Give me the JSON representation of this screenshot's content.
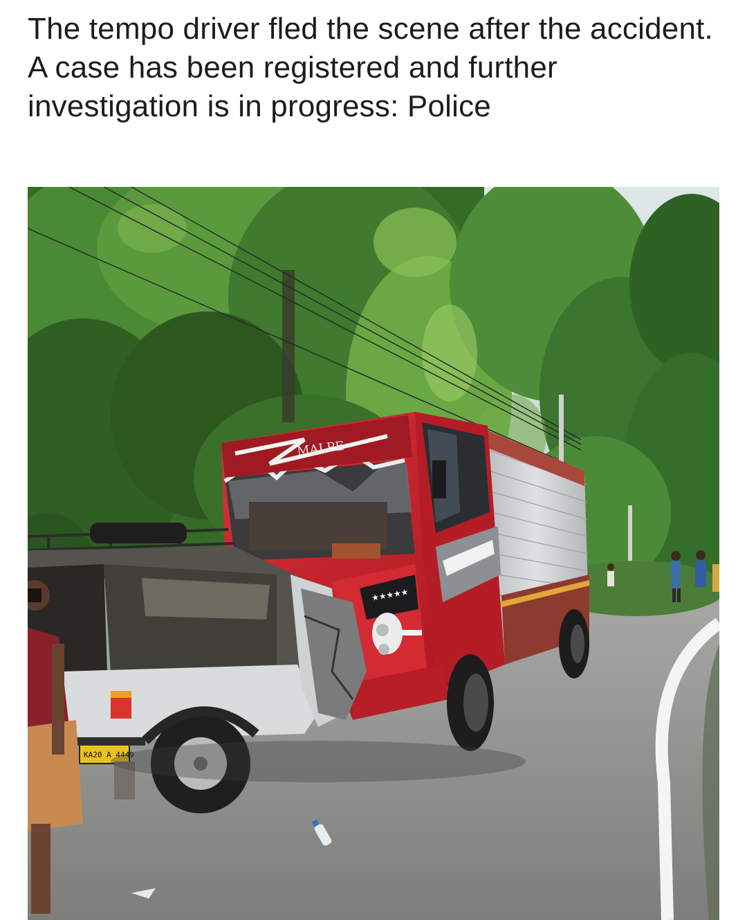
{
  "article": {
    "caption": "The tempo driver fled the scene after the accident. A case has been registered and further investigation is in progress: Police"
  },
  "photo": {
    "truck_logo_text": "MALPE",
    "jeep_plate_text": "KA20 A 4449"
  },
  "colors": {
    "text": "#1c1c1c",
    "truck_red": "#c4202a",
    "foliage": "#3f7a2e",
    "road": "#8c8c8a"
  }
}
